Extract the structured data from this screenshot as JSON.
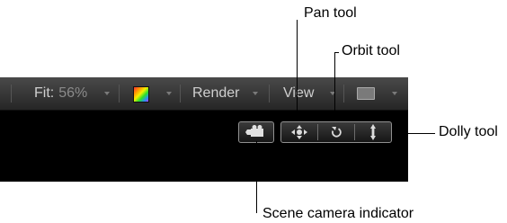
{
  "toolbar": {
    "fit_label": "Fit:",
    "fit_value": "56%",
    "render_label": "Render",
    "view_label": "View"
  },
  "callouts": {
    "pan": "Pan tool",
    "orbit": "Orbit tool",
    "dolly": "Dolly tool",
    "camera": "Scene camera indicator"
  },
  "icons": {
    "camera": "camera-icon",
    "pan": "pan-arrows-icon",
    "orbit": "orbit-icon",
    "dolly": "dolly-arrows-icon",
    "color": "color-channels-icon",
    "display": "display-monitor-icon"
  }
}
